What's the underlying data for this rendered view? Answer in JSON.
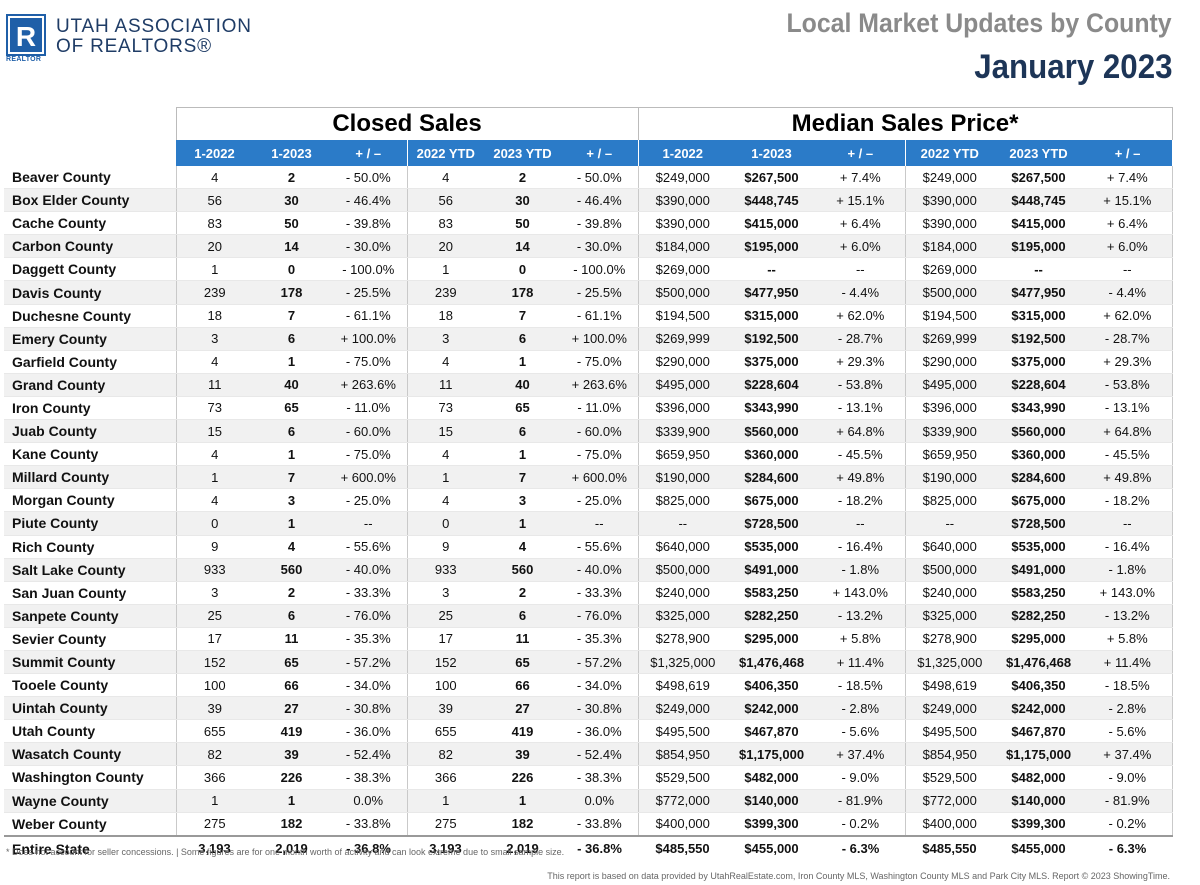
{
  "logo": {
    "mark_letter": "R",
    "sub": "REALTOR",
    "line1": "UTAH ASSOCIATION",
    "line2": "OF REALTORS®",
    "color": "#1f5fa8"
  },
  "header": {
    "title": "Local Market Updates by County",
    "subtitle": "January 2023"
  },
  "table": {
    "groups": [
      "Closed Sales",
      "Median Sales Price*"
    ],
    "columns": [
      "1-2022",
      "1-2023",
      "+ / –",
      "2022 YTD",
      "2023 YTD",
      "+ / –",
      "1-2022",
      "1-2023",
      "+ / –",
      "2022 YTD",
      "2023 YTD",
      "+ / –"
    ],
    "header_color": "#2b7bc8",
    "rows": [
      [
        "Beaver County",
        "4",
        "2",
        "- 50.0%",
        "4",
        "2",
        "- 50.0%",
        "$249,000",
        "$267,500",
        "+ 7.4%",
        "$249,000",
        "$267,500",
        "+ 7.4%"
      ],
      [
        "Box Elder County",
        "56",
        "30",
        "- 46.4%",
        "56",
        "30",
        "- 46.4%",
        "$390,000",
        "$448,745",
        "+ 15.1%",
        "$390,000",
        "$448,745",
        "+ 15.1%"
      ],
      [
        "Cache County",
        "83",
        "50",
        "- 39.8%",
        "83",
        "50",
        "- 39.8%",
        "$390,000",
        "$415,000",
        "+ 6.4%",
        "$390,000",
        "$415,000",
        "+ 6.4%"
      ],
      [
        "Carbon County",
        "20",
        "14",
        "- 30.0%",
        "20",
        "14",
        "- 30.0%",
        "$184,000",
        "$195,000",
        "+ 6.0%",
        "$184,000",
        "$195,000",
        "+ 6.0%"
      ],
      [
        "Daggett County",
        "1",
        "0",
        "- 100.0%",
        "1",
        "0",
        "- 100.0%",
        "$269,000",
        "--",
        "--",
        "$269,000",
        "--",
        "--"
      ],
      [
        "Davis County",
        "239",
        "178",
        "- 25.5%",
        "239",
        "178",
        "- 25.5%",
        "$500,000",
        "$477,950",
        "- 4.4%",
        "$500,000",
        "$477,950",
        "- 4.4%"
      ],
      [
        "Duchesne County",
        "18",
        "7",
        "- 61.1%",
        "18",
        "7",
        "- 61.1%",
        "$194,500",
        "$315,000",
        "+ 62.0%",
        "$194,500",
        "$315,000",
        "+ 62.0%"
      ],
      [
        "Emery County",
        "3",
        "6",
        "+ 100.0%",
        "3",
        "6",
        "+ 100.0%",
        "$269,999",
        "$192,500",
        "- 28.7%",
        "$269,999",
        "$192,500",
        "- 28.7%"
      ],
      [
        "Garfield County",
        "4",
        "1",
        "- 75.0%",
        "4",
        "1",
        "- 75.0%",
        "$290,000",
        "$375,000",
        "+ 29.3%",
        "$290,000",
        "$375,000",
        "+ 29.3%"
      ],
      [
        "Grand County",
        "11",
        "40",
        "+ 263.6%",
        "11",
        "40",
        "+ 263.6%",
        "$495,000",
        "$228,604",
        "- 53.8%",
        "$495,000",
        "$228,604",
        "- 53.8%"
      ],
      [
        "Iron County",
        "73",
        "65",
        "- 11.0%",
        "73",
        "65",
        "- 11.0%",
        "$396,000",
        "$343,990",
        "- 13.1%",
        "$396,000",
        "$343,990",
        "- 13.1%"
      ],
      [
        "Juab County",
        "15",
        "6",
        "- 60.0%",
        "15",
        "6",
        "- 60.0%",
        "$339,900",
        "$560,000",
        "+ 64.8%",
        "$339,900",
        "$560,000",
        "+ 64.8%"
      ],
      [
        "Kane County",
        "4",
        "1",
        "- 75.0%",
        "4",
        "1",
        "- 75.0%",
        "$659,950",
        "$360,000",
        "- 45.5%",
        "$659,950",
        "$360,000",
        "- 45.5%"
      ],
      [
        "Millard County",
        "1",
        "7",
        "+ 600.0%",
        "1",
        "7",
        "+ 600.0%",
        "$190,000",
        "$284,600",
        "+ 49.8%",
        "$190,000",
        "$284,600",
        "+ 49.8%"
      ],
      [
        "Morgan County",
        "4",
        "3",
        "- 25.0%",
        "4",
        "3",
        "- 25.0%",
        "$825,000",
        "$675,000",
        "- 18.2%",
        "$825,000",
        "$675,000",
        "- 18.2%"
      ],
      [
        "Piute County",
        "0",
        "1",
        "--",
        "0",
        "1",
        "--",
        "--",
        "$728,500",
        "--",
        "--",
        "$728,500",
        "--"
      ],
      [
        "Rich County",
        "9",
        "4",
        "- 55.6%",
        "9",
        "4",
        "- 55.6%",
        "$640,000",
        "$535,000",
        "- 16.4%",
        "$640,000",
        "$535,000",
        "- 16.4%"
      ],
      [
        "Salt Lake County",
        "933",
        "560",
        "- 40.0%",
        "933",
        "560",
        "- 40.0%",
        "$500,000",
        "$491,000",
        "- 1.8%",
        "$500,000",
        "$491,000",
        "- 1.8%"
      ],
      [
        "San Juan County",
        "3",
        "2",
        "- 33.3%",
        "3",
        "2",
        "- 33.3%",
        "$240,000",
        "$583,250",
        "+ 143.0%",
        "$240,000",
        "$583,250",
        "+ 143.0%"
      ],
      [
        "Sanpete County",
        "25",
        "6",
        "- 76.0%",
        "25",
        "6",
        "- 76.0%",
        "$325,000",
        "$282,250",
        "- 13.2%",
        "$325,000",
        "$282,250",
        "- 13.2%"
      ],
      [
        "Sevier County",
        "17",
        "11",
        "- 35.3%",
        "17",
        "11",
        "- 35.3%",
        "$278,900",
        "$295,000",
        "+ 5.8%",
        "$278,900",
        "$295,000",
        "+ 5.8%"
      ],
      [
        "Summit County",
        "152",
        "65",
        "- 57.2%",
        "152",
        "65",
        "- 57.2%",
        "$1,325,000",
        "$1,476,468",
        "+ 11.4%",
        "$1,325,000",
        "$1,476,468",
        "+ 11.4%"
      ],
      [
        "Tooele County",
        "100",
        "66",
        "- 34.0%",
        "100",
        "66",
        "- 34.0%",
        "$498,619",
        "$406,350",
        "- 18.5%",
        "$498,619",
        "$406,350",
        "- 18.5%"
      ],
      [
        "Uintah County",
        "39",
        "27",
        "- 30.8%",
        "39",
        "27",
        "- 30.8%",
        "$249,000",
        "$242,000",
        "- 2.8%",
        "$249,000",
        "$242,000",
        "- 2.8%"
      ],
      [
        "Utah County",
        "655",
        "419",
        "- 36.0%",
        "655",
        "419",
        "- 36.0%",
        "$495,500",
        "$467,870",
        "- 5.6%",
        "$495,500",
        "$467,870",
        "- 5.6%"
      ],
      [
        "Wasatch County",
        "82",
        "39",
        "- 52.4%",
        "82",
        "39",
        "- 52.4%",
        "$854,950",
        "$1,175,000",
        "+ 37.4%",
        "$854,950",
        "$1,175,000",
        "+ 37.4%"
      ],
      [
        "Washington County",
        "366",
        "226",
        "- 38.3%",
        "366",
        "226",
        "- 38.3%",
        "$529,500",
        "$482,000",
        "- 9.0%",
        "$529,500",
        "$482,000",
        "- 9.0%"
      ],
      [
        "Wayne County",
        "1",
        "1",
        "0.0%",
        "1",
        "1",
        "0.0%",
        "$772,000",
        "$140,000",
        "- 81.9%",
        "$772,000",
        "$140,000",
        "- 81.9%"
      ],
      [
        "Weber County",
        "275",
        "182",
        "- 33.8%",
        "275",
        "182",
        "- 33.8%",
        "$400,000",
        "$399,300",
        "- 0.2%",
        "$400,000",
        "$399,300",
        "- 0.2%"
      ]
    ],
    "total": [
      "Entire State",
      "3,193",
      "2,019",
      "- 36.8%",
      "3,193",
      "2,019",
      "- 36.8%",
      "$485,550",
      "$455,000",
      "- 6.3%",
      "$485,550",
      "$455,000",
      "- 6.3%"
    ]
  },
  "footer": {
    "note": "* Does not account for seller concessions. | Some figures are for one month worth of activity and can look extreme due to small sample size.",
    "source": "This report is based on data provided by UtahRealEstate.com, Iron County MLS, Washington County MLS and Park City MLS. Report © 2023 ShowingTime."
  }
}
